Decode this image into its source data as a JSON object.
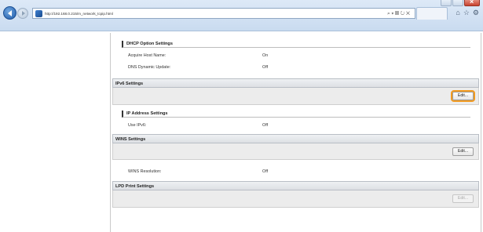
{
  "browser": {
    "url": "http://192.168.0.215/m_network_tcpip.html",
    "address_tools": "⌕ ▾ ▤ ↻ ✕",
    "tab_icons": [
      "⌂",
      "☆",
      "⚙"
    ]
  },
  "sections": {
    "dhcp_option": {
      "title": "DHCP Option Settings",
      "rows": [
        {
          "label": "Acquire Host Name:",
          "value": "On"
        },
        {
          "label": "DNS Dynamic Update:",
          "value": "Off"
        }
      ]
    },
    "ipv6": {
      "title": "IPv6 Settings",
      "edit_label": "Edit...",
      "sub_title": "IP Address Settings",
      "rows": [
        {
          "label": "Use IPv6:",
          "value": "Off"
        }
      ]
    },
    "wins": {
      "title": "WINS Settings",
      "edit_label": "Edit...",
      "rows": [
        {
          "label": "WINS Resolution:",
          "value": "Off"
        }
      ]
    },
    "lpd": {
      "title": "LPD Print Settings",
      "edit_label": "Edit..."
    }
  },
  "colors": {
    "highlight": "#f29a1f",
    "close_button": "#c8432f"
  }
}
